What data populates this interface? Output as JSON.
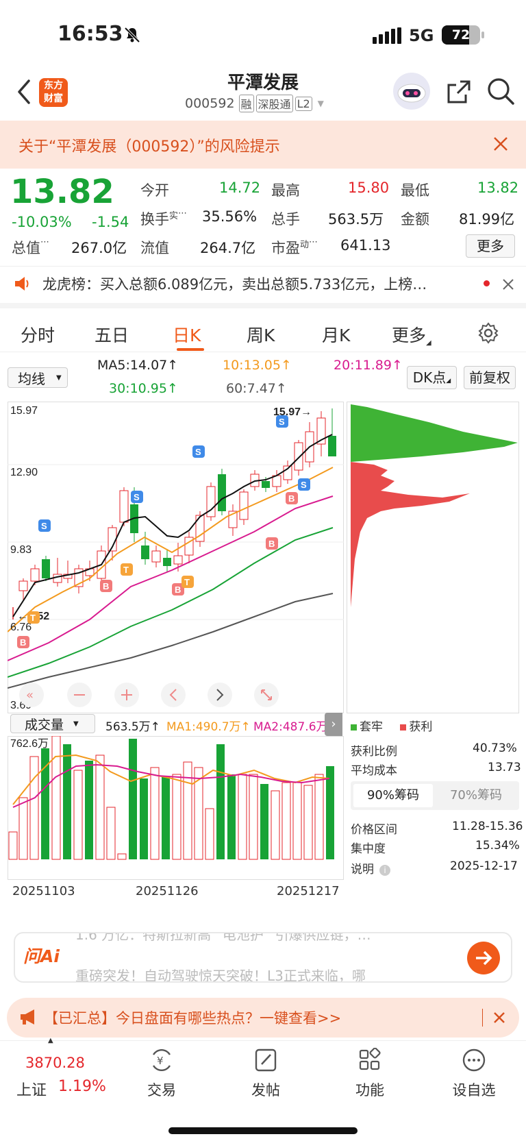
{
  "status_bar": {
    "time": "16:53",
    "network": "5G",
    "battery": "72"
  },
  "header": {
    "back_icon": "chevron-left-icon",
    "logo_text_top": "东方",
    "logo_text_bottom": "财富",
    "stock_name": "平潭发展",
    "stock_code": "000592",
    "tags": [
      "融",
      "深股通",
      "L2"
    ],
    "share_icon": "share-icon",
    "search_icon": "search-icon"
  },
  "alert": {
    "text": "关于“平潭发展（000592）”的风险提示"
  },
  "quote": {
    "price": "13.82",
    "change_pct": "-10.03%",
    "change_amt": "-1.54",
    "open_label": "今开",
    "open": "14.72",
    "high_label": "最高",
    "high": "15.80",
    "low_label": "最低",
    "low": "13.82",
    "turnover_label": "换手",
    "turnover_sup": "实",
    "turnover": "35.56%",
    "volume_label": "总手",
    "volume": "563.5万",
    "amount_label": "金额",
    "amount": "81.99亿",
    "mktcap_label": "总值",
    "mktcap": "267.0亿",
    "float_label": "流值",
    "float": "264.7亿",
    "pe_label": "市盈",
    "pe_sup": "动",
    "pe": "641.13",
    "more_button": "更多"
  },
  "lhb": {
    "text": "龙虎榜：买入总额6.089亿元，卖出总额5.733亿元，上榜…"
  },
  "tabs": [
    "分时",
    "五日",
    "日K",
    "周K",
    "月K",
    "更多"
  ],
  "active_tab": 2,
  "ma_bar": {
    "select": "均线",
    "ma5": "MA5:14.07↑",
    "ma10": "10:13.05↑",
    "ma20": "20:11.89↑",
    "ma30": "30:10.95↑",
    "ma60": "60:7.47↑",
    "dk_button": "DK点",
    "fq_button": "前复权"
  },
  "kline": {
    "y_labels": [
      "15.97",
      "12.90",
      "9.83",
      "6.76",
      "3.69"
    ],
    "max_label": "15.97→",
    "min_label": "←7.52",
    "colors": {
      "up": "#e4262b",
      "down": "#18a336",
      "ma5": "#111111",
      "ma10": "#f39a1e",
      "ma20": "#d81b8f",
      "ma30": "#18a336",
      "ma60": "#555555"
    }
  },
  "volume": {
    "select": "成交量",
    "vol": "563.5万↑",
    "ma1": "MA1:490.7万↑",
    "ma2": "MA2:487.6万",
    "max_label": "762.6万",
    "dates": [
      "20251103",
      "20251126",
      "20251217"
    ]
  },
  "chips": {
    "legend_trap": "套牢",
    "legend_profit": "获利",
    "profit_ratio_label": "获利比例",
    "profit_ratio": "40.73%",
    "avg_cost_label": "平均成本",
    "avg_cost": "13.73",
    "tab_90": "90%筹码",
    "tab_70": "70%筹码",
    "range_label": "价格区间",
    "range": "11.28-15.36",
    "conc_label": "集中度",
    "conc": "15.34%",
    "note_label": "说明",
    "date": "2025-12-17"
  },
  "ai": {
    "label": "问Ai",
    "line1": "1.6 万亿：特斯拉新高 “电池护” 引爆供应链，…",
    "line2": "重磅突发！自动驾驶惊天突破！L3正式来临，哪"
  },
  "promo": {
    "text": "【已汇总】今日盘面有哪些热点？一键查看>>"
  },
  "bottom_nav": {
    "index_value": "3870.28",
    "index_name": "上证",
    "index_change": "1.19%",
    "items": [
      "交易",
      "发帖",
      "功能",
      "设自选"
    ]
  }
}
